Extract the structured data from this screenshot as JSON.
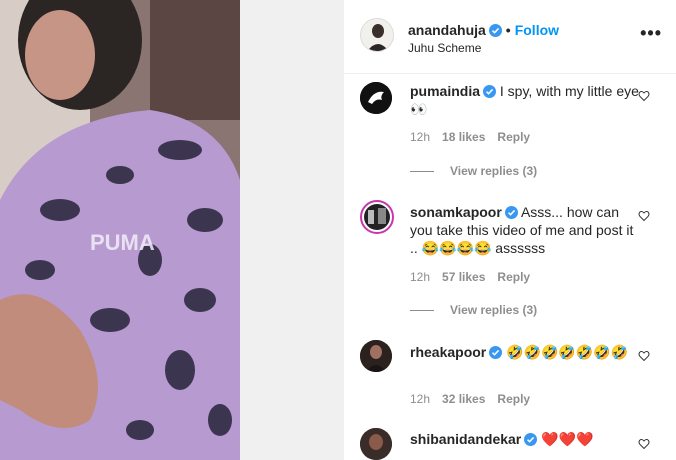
{
  "post": {
    "username": "anandahuja",
    "follow_label": "Follow",
    "location": "Juhu Scheme",
    "more_label": "•••",
    "separator": "•"
  },
  "media": {
    "shirt_text": "PUMA"
  },
  "comments": [
    {
      "username": "pumaindia",
      "text": "I spy, with my little eye",
      "emoji_text": "👀",
      "time": "12h",
      "likes": "18 likes",
      "reply_label": "Reply",
      "view_replies": "View replies (3)"
    },
    {
      "username": "sonamkapoor",
      "text": "Asss... how can you take this video of me and post it ..",
      "emoji_text": "😂😂😂😂",
      "trailing_text": "assssss",
      "time": "12h",
      "likes": "57 likes",
      "reply_label": "Reply",
      "view_replies": "View replies (3)"
    },
    {
      "username": "rheakapoor",
      "text": "",
      "emoji_text": "🤣🤣🤣🤣🤣🤣🤣",
      "time": "12h",
      "likes": "32 likes",
      "reply_label": "Reply"
    },
    {
      "username": "shibanidandekar",
      "text": "",
      "emoji_text": "❤️❤️❤️"
    }
  ],
  "colors": {
    "link": "#0095f6",
    "verified": "#3897f0",
    "muted": "#8e8e8e",
    "shirt": "#b79ad0"
  }
}
